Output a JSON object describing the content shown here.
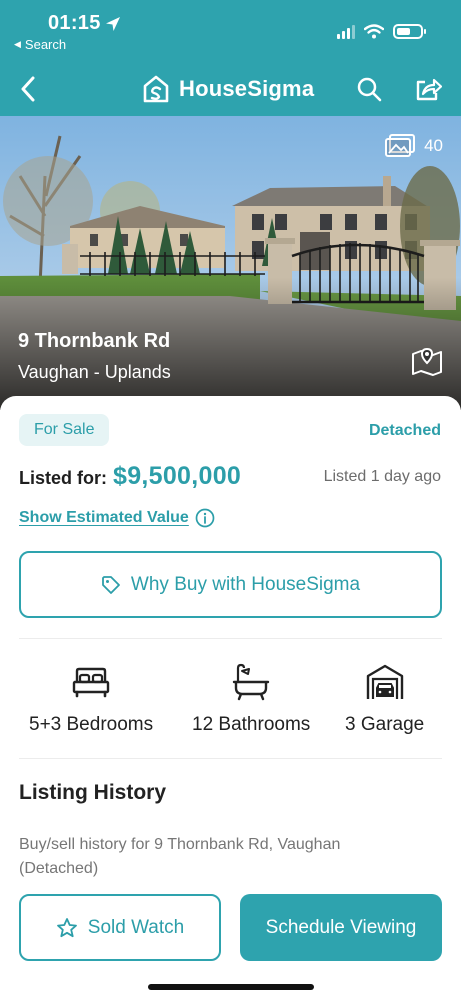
{
  "status_bar": {
    "time": "01:15",
    "back_app": "Search",
    "icons": [
      "location-arrow-icon",
      "signal-icon",
      "wifi-icon",
      "battery-icon"
    ]
  },
  "header": {
    "brand": "HouseSigma",
    "icons": [
      "back-chevron-icon",
      "housesigma-logo-icon",
      "search-icon",
      "share-icon"
    ],
    "color": "#2ea3ae"
  },
  "hero": {
    "photo_count": "40",
    "address": "9 Thornbank Rd",
    "area": "Vaughan - Uplands",
    "icons": [
      "photos-icon",
      "map-icon"
    ]
  },
  "listing": {
    "status_badge": "For Sale",
    "property_type": "Detached",
    "price_label": "Listed for:",
    "price": "$9,500,000",
    "listed_ago": "Listed 1 day ago",
    "estimate_link": "Show Estimated Value",
    "why_buy": "Why Buy with HouseSigma"
  },
  "features": [
    {
      "icon": "bed-icon",
      "label": "5+3 Bedrooms"
    },
    {
      "icon": "bathtub-icon",
      "label": "12 Bathrooms"
    },
    {
      "icon": "garage-icon",
      "label": "3 Garage"
    }
  ],
  "history": {
    "title": "Listing History",
    "description": "Buy/sell history for 9 Thornbank Rd, Vaughan (Detached)"
  },
  "actions": {
    "watch": "Sold Watch",
    "schedule": "Schedule Viewing"
  },
  "colors": {
    "accent": "#2ea3ae",
    "accent_text": "#2c9ea9",
    "badge_bg": "#e6f4f5"
  }
}
